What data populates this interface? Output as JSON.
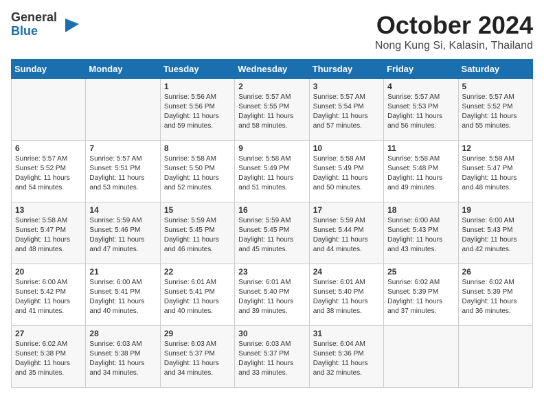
{
  "logo": {
    "general": "General",
    "blue": "Blue"
  },
  "title": "October 2024",
  "subtitle": "Nong Kung Si, Kalasin, Thailand",
  "weekdays": [
    "Sunday",
    "Monday",
    "Tuesday",
    "Wednesday",
    "Thursday",
    "Friday",
    "Saturday"
  ],
  "weeks": [
    [
      {
        "day": "",
        "info": ""
      },
      {
        "day": "",
        "info": ""
      },
      {
        "day": "1",
        "info": "Sunrise: 5:56 AM\nSunset: 5:56 PM\nDaylight: 11 hours\nand 59 minutes."
      },
      {
        "day": "2",
        "info": "Sunrise: 5:57 AM\nSunset: 5:55 PM\nDaylight: 11 hours\nand 58 minutes."
      },
      {
        "day": "3",
        "info": "Sunrise: 5:57 AM\nSunset: 5:54 PM\nDaylight: 11 hours\nand 57 minutes."
      },
      {
        "day": "4",
        "info": "Sunrise: 5:57 AM\nSunset: 5:53 PM\nDaylight: 11 hours\nand 56 minutes."
      },
      {
        "day": "5",
        "info": "Sunrise: 5:57 AM\nSunset: 5:52 PM\nDaylight: 11 hours\nand 55 minutes."
      }
    ],
    [
      {
        "day": "6",
        "info": "Sunrise: 5:57 AM\nSunset: 5:52 PM\nDaylight: 11 hours\nand 54 minutes."
      },
      {
        "day": "7",
        "info": "Sunrise: 5:57 AM\nSunset: 5:51 PM\nDaylight: 11 hours\nand 53 minutes."
      },
      {
        "day": "8",
        "info": "Sunrise: 5:58 AM\nSunset: 5:50 PM\nDaylight: 11 hours\nand 52 minutes."
      },
      {
        "day": "9",
        "info": "Sunrise: 5:58 AM\nSunset: 5:49 PM\nDaylight: 11 hours\nand 51 minutes."
      },
      {
        "day": "10",
        "info": "Sunrise: 5:58 AM\nSunset: 5:49 PM\nDaylight: 11 hours\nand 50 minutes."
      },
      {
        "day": "11",
        "info": "Sunrise: 5:58 AM\nSunset: 5:48 PM\nDaylight: 11 hours\nand 49 minutes."
      },
      {
        "day": "12",
        "info": "Sunrise: 5:58 AM\nSunset: 5:47 PM\nDaylight: 11 hours\nand 48 minutes."
      }
    ],
    [
      {
        "day": "13",
        "info": "Sunrise: 5:58 AM\nSunset: 5:47 PM\nDaylight: 11 hours\nand 48 minutes."
      },
      {
        "day": "14",
        "info": "Sunrise: 5:59 AM\nSunset: 5:46 PM\nDaylight: 11 hours\nand 47 minutes."
      },
      {
        "day": "15",
        "info": "Sunrise: 5:59 AM\nSunset: 5:45 PM\nDaylight: 11 hours\nand 46 minutes."
      },
      {
        "day": "16",
        "info": "Sunrise: 5:59 AM\nSunset: 5:45 PM\nDaylight: 11 hours\nand 45 minutes."
      },
      {
        "day": "17",
        "info": "Sunrise: 5:59 AM\nSunset: 5:44 PM\nDaylight: 11 hours\nand 44 minutes."
      },
      {
        "day": "18",
        "info": "Sunrise: 6:00 AM\nSunset: 5:43 PM\nDaylight: 11 hours\nand 43 minutes."
      },
      {
        "day": "19",
        "info": "Sunrise: 6:00 AM\nSunset: 5:43 PM\nDaylight: 11 hours\nand 42 minutes."
      }
    ],
    [
      {
        "day": "20",
        "info": "Sunrise: 6:00 AM\nSunset: 5:42 PM\nDaylight: 11 hours\nand 41 minutes."
      },
      {
        "day": "21",
        "info": "Sunrise: 6:00 AM\nSunset: 5:41 PM\nDaylight: 11 hours\nand 40 minutes."
      },
      {
        "day": "22",
        "info": "Sunrise: 6:01 AM\nSunset: 5:41 PM\nDaylight: 11 hours\nand 40 minutes."
      },
      {
        "day": "23",
        "info": "Sunrise: 6:01 AM\nSunset: 5:40 PM\nDaylight: 11 hours\nand 39 minutes."
      },
      {
        "day": "24",
        "info": "Sunrise: 6:01 AM\nSunset: 5:40 PM\nDaylight: 11 hours\nand 38 minutes."
      },
      {
        "day": "25",
        "info": "Sunrise: 6:02 AM\nSunset: 5:39 PM\nDaylight: 11 hours\nand 37 minutes."
      },
      {
        "day": "26",
        "info": "Sunrise: 6:02 AM\nSunset: 5:39 PM\nDaylight: 11 hours\nand 36 minutes."
      }
    ],
    [
      {
        "day": "27",
        "info": "Sunrise: 6:02 AM\nSunset: 5:38 PM\nDaylight: 11 hours\nand 35 minutes."
      },
      {
        "day": "28",
        "info": "Sunrise: 6:03 AM\nSunset: 5:38 PM\nDaylight: 11 hours\nand 34 minutes."
      },
      {
        "day": "29",
        "info": "Sunrise: 6:03 AM\nSunset: 5:37 PM\nDaylight: 11 hours\nand 34 minutes."
      },
      {
        "day": "30",
        "info": "Sunrise: 6:03 AM\nSunset: 5:37 PM\nDaylight: 11 hours\nand 33 minutes."
      },
      {
        "day": "31",
        "info": "Sunrise: 6:04 AM\nSunset: 5:36 PM\nDaylight: 11 hours\nand 32 minutes."
      },
      {
        "day": "",
        "info": ""
      },
      {
        "day": "",
        "info": ""
      }
    ]
  ]
}
